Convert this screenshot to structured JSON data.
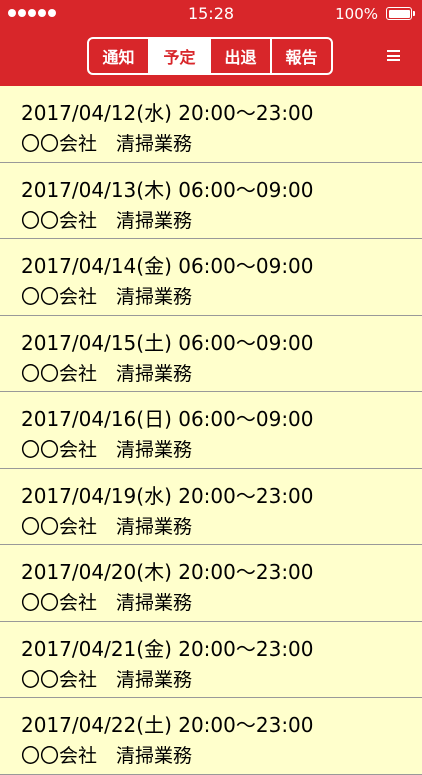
{
  "status_bar": {
    "time": "15:28",
    "battery_percent": "100%"
  },
  "nav": {
    "tabs": [
      {
        "label": "通知",
        "active": false
      },
      {
        "label": "予定",
        "active": true
      },
      {
        "label": "出退",
        "active": false
      },
      {
        "label": "報告",
        "active": false
      }
    ],
    "menu_icon": "hamburger-menu-icon"
  },
  "schedule": [
    {
      "datetime": "2017/04/12(水) 20:00〜23:00",
      "description": "〇〇会社　清掃業務"
    },
    {
      "datetime": "2017/04/13(木) 06:00〜09:00",
      "description": "〇〇会社　清掃業務"
    },
    {
      "datetime": "2017/04/14(金) 06:00〜09:00",
      "description": "〇〇会社　清掃業務"
    },
    {
      "datetime": "2017/04/15(土) 06:00〜09:00",
      "description": "〇〇会社　清掃業務"
    },
    {
      "datetime": "2017/04/16(日) 06:00〜09:00",
      "description": "〇〇会社　清掃業務"
    },
    {
      "datetime": "2017/04/19(水) 20:00〜23:00",
      "description": "〇〇会社　清掃業務"
    },
    {
      "datetime": "2017/04/20(木) 20:00〜23:00",
      "description": "〇〇会社　清掃業務"
    },
    {
      "datetime": "2017/04/21(金) 20:00〜23:00",
      "description": "〇〇会社　清掃業務"
    },
    {
      "datetime": "2017/04/22(土) 20:00〜23:00",
      "description": "〇〇会社　清掃業務"
    }
  ],
  "colors": {
    "header_bg": "#d8262a",
    "list_bg": "#ffffcc",
    "divider": "#999999"
  }
}
